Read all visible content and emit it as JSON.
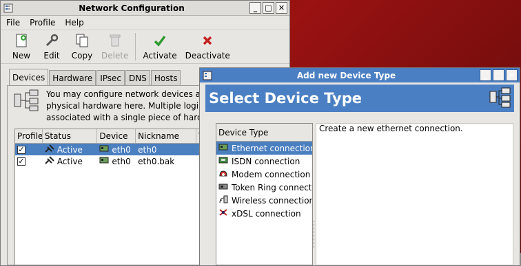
{
  "network_window": {
    "title": "Network Configuration",
    "menu": [
      "File",
      "Profile",
      "Help"
    ],
    "toolbar": {
      "new": "New",
      "edit": "Edit",
      "copy": "Copy",
      "delete": "Delete",
      "activate": "Activate",
      "deactivate": "Deactivate"
    },
    "tabs": [
      "Devices",
      "Hardware",
      "IPsec",
      "DNS",
      "Hosts"
    ],
    "info_lines": [
      "You may configure network devices a",
      "physical hardware here.  Multiple logi",
      "associated with a single piece of hard"
    ],
    "table": {
      "columns": [
        "Profile",
        "Status",
        "Device",
        "Nickname",
        "T"
      ],
      "rows": [
        {
          "status": "Active",
          "device": "eth0",
          "nickname": "eth0",
          "type": "E"
        },
        {
          "status": "Active",
          "device": "eth0",
          "nickname": "eth0.bak",
          "type": "E"
        }
      ]
    }
  },
  "add_dialog": {
    "title": "Add new Device Type",
    "banner": "Select Device Type",
    "list_header": "Device Type",
    "items": [
      {
        "label": "Ethernet connection",
        "icon": "ethernet-icon"
      },
      {
        "label": "ISDN connection",
        "icon": "isdn-icon"
      },
      {
        "label": "Modem connection",
        "icon": "modem-icon"
      },
      {
        "label": "Token Ring connection",
        "icon": "token-ring-icon"
      },
      {
        "label": "Wireless connection",
        "icon": "wireless-icon"
      },
      {
        "label": "xDSL connection",
        "icon": "xdsl-icon"
      }
    ],
    "description": "Create a new ethernet connection."
  },
  "colors": {
    "selection": "#4a7fc0",
    "dialog_title": "#4b7fc3",
    "desktop": "#8b1010"
  }
}
